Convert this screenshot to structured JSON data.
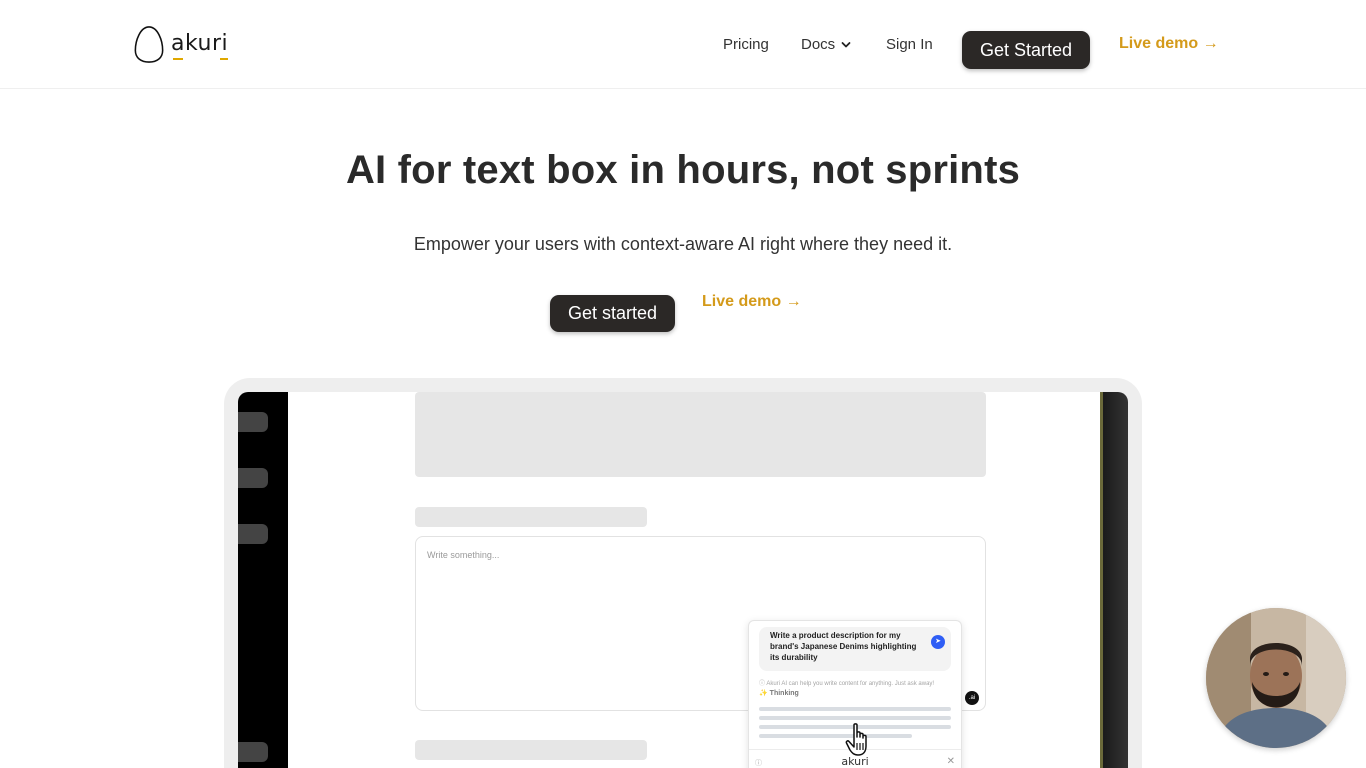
{
  "brand": {
    "name": "akuri"
  },
  "nav": {
    "pricing": "Pricing",
    "docs": "Docs",
    "sign_in": "Sign In",
    "get_started": "Get Started",
    "live_demo": "Live demo →"
  },
  "hero": {
    "title": "AI for text box in hours, not sprints",
    "subtitle": "Empower your users with context-aware AI right where they need it.",
    "cta": "Get started",
    "live_demo": "Live demo →"
  },
  "demo": {
    "textarea_placeholder": "Write something...",
    "prompt": "Write a product description for my brand's Japanese Denims highlighting its durability",
    "hint": "ⓘ Akuri AI can help you write content for anything. Just ask away!",
    "thinking": "Thinking",
    "footer_brand": "akuri",
    "mini_logo": ".ai"
  },
  "colors": {
    "accent": "#d49a1a",
    "button_dark": "#2b2826",
    "send_blue": "#2f5ef5"
  },
  "icons": [
    "chevron-down-icon",
    "send-icon",
    "help-icon",
    "close-icon",
    "pointer-hand-icon",
    "sparkle-icon"
  ]
}
